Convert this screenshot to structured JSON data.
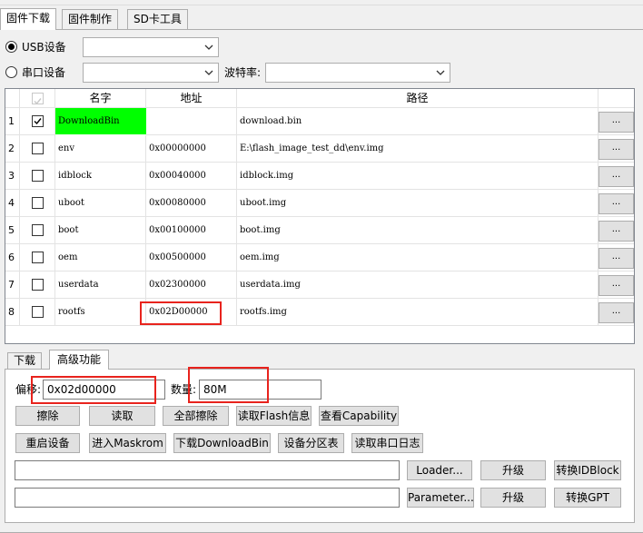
{
  "tabs": [
    "固件下载",
    "固件制作",
    "SD卡工具"
  ],
  "device": {
    "usb_label": "USB设备",
    "serial_label": "串口设备",
    "baud_label": "波特率:",
    "usb_value": "",
    "serial_value": "",
    "baud_value": ""
  },
  "table": {
    "headers": [
      "名字",
      "地址",
      "路径"
    ],
    "rows": [
      {
        "idx": "1",
        "checked": true,
        "name": "DownloadBin",
        "addr": "",
        "path": "download.bin",
        "highlight": true
      },
      {
        "idx": "2",
        "checked": false,
        "name": "env",
        "addr": "0x00000000",
        "path": "E:\\flash_image_test_dd\\env.img"
      },
      {
        "idx": "3",
        "checked": false,
        "name": "idblock",
        "addr": "0x00040000",
        "path": "idblock.img"
      },
      {
        "idx": "4",
        "checked": false,
        "name": "uboot",
        "addr": "0x00080000",
        "path": "uboot.img"
      },
      {
        "idx": "5",
        "checked": false,
        "name": "boot",
        "addr": "0x00100000",
        "path": "boot.img"
      },
      {
        "idx": "6",
        "checked": false,
        "name": "oem",
        "addr": "0x00500000",
        "path": "oem.img"
      },
      {
        "idx": "7",
        "checked": false,
        "name": "userdata",
        "addr": "0x02300000",
        "path": "userdata.img"
      },
      {
        "idx": "8",
        "checked": false,
        "name": "rootfs",
        "addr": "0x02D00000",
        "path": "rootfs.img"
      }
    ],
    "browse_label": "..."
  },
  "bottom_tabs": [
    "下载",
    "高级功能"
  ],
  "advanced": {
    "offset_label": "偏移:",
    "offset_value": "0x02d00000",
    "count_label": "数量:",
    "count_value": "80M",
    "buttons_row1": [
      "擦除",
      "读取",
      "全部擦除",
      "读取Flash信息",
      "查看Capability"
    ],
    "buttons_row2": [
      "重启设备",
      "进入Maskrom",
      "下载DownloadBin",
      "设备分区表",
      "读取串口日志"
    ],
    "loader_path": "",
    "parameter_path": "",
    "loader_button": "Loader...",
    "parameter_button": "Parameter...",
    "upgrade_label": "升级",
    "convert_idblock": "转换IDBlock",
    "convert_gpt": "转换GPT"
  },
  "colors": {
    "highlight": "#00ff00",
    "annotation": "#e8231d"
  }
}
